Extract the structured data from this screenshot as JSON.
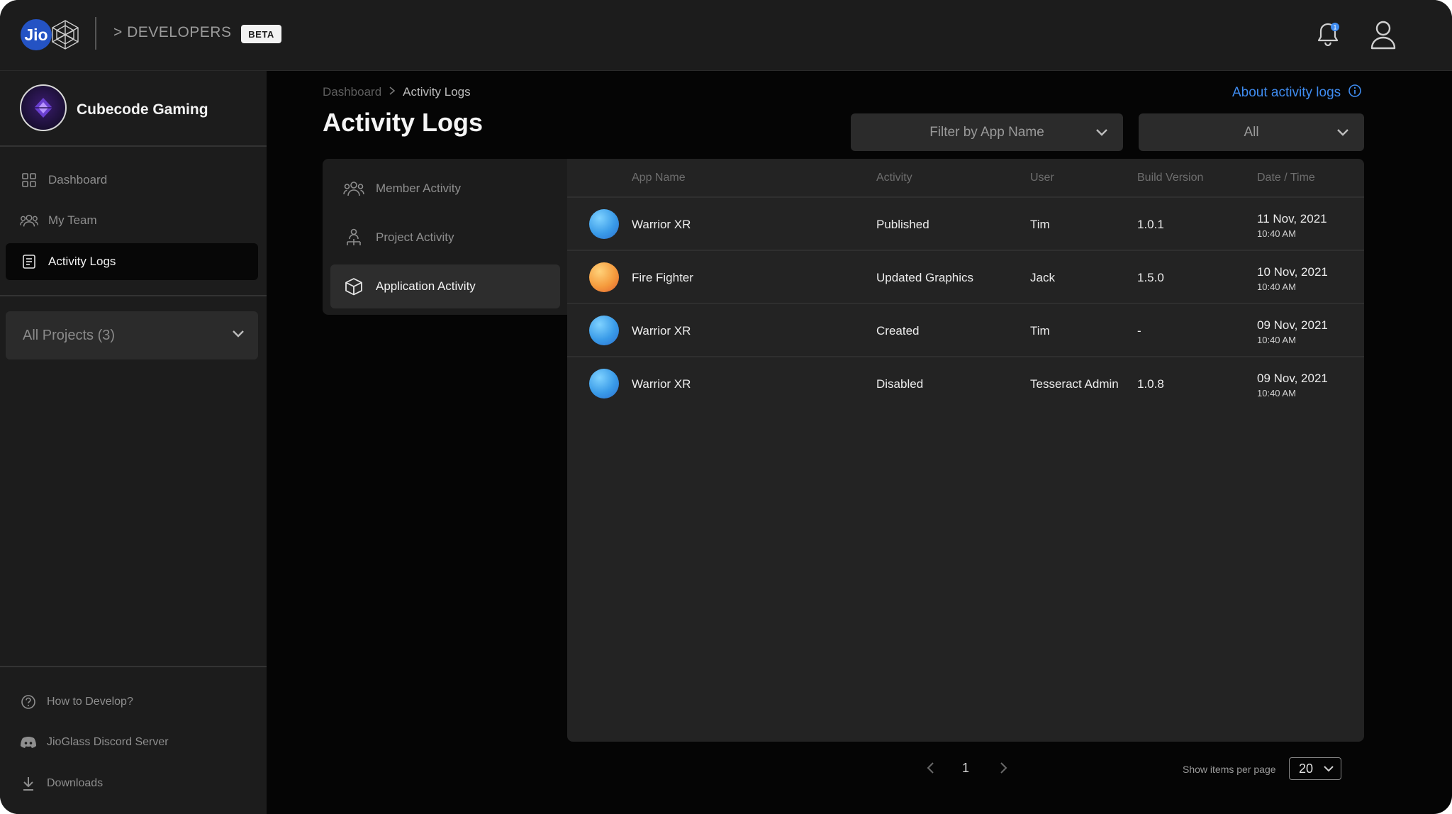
{
  "topbar": {
    "logo_text": "Jio",
    "section_label": "> DEVELOPERS",
    "badge": "BETA",
    "notification_count": "1"
  },
  "sidebar": {
    "org_name": "Cubecode Gaming",
    "nav": [
      {
        "label": "Dashboard",
        "icon": "dashboard-icon",
        "active": false
      },
      {
        "label": "My Team",
        "icon": "team-icon",
        "active": false
      },
      {
        "label": "Activity Logs",
        "icon": "logs-icon",
        "active": true
      }
    ],
    "projects_select": "All Projects (3)",
    "bottom": [
      {
        "label": "How to Develop?",
        "icon": "help-icon"
      },
      {
        "label": "JioGlass Discord Server",
        "icon": "discord-icon"
      },
      {
        "label": "Downloads",
        "icon": "download-icon"
      }
    ]
  },
  "main": {
    "breadcrumb": [
      "Dashboard",
      "Activity Logs"
    ],
    "about_link": "About activity logs",
    "title": "Activity Logs",
    "filter_app_placeholder": "Filter by App Name",
    "filter_status": "All",
    "tabs": [
      {
        "label": "Member Activity",
        "icon": "members-icon",
        "active": false
      },
      {
        "label": "Project Activity",
        "icon": "project-icon",
        "active": false
      },
      {
        "label": "Application Activity",
        "icon": "cube-icon",
        "active": true
      }
    ],
    "table": {
      "headers": [
        "App Name",
        "Activity",
        "User",
        "Build Version",
        "Date / Time"
      ],
      "rows": [
        {
          "app": "Warrior XR",
          "color": "blue",
          "activity": "Published",
          "user": "Tim",
          "build": "1.0.1",
          "date": "11 Nov, 2021",
          "time": "10:40 AM"
        },
        {
          "app": "Fire Fighter",
          "color": "orange",
          "activity": "Updated Graphics",
          "user": "Jack",
          "build": "1.5.0",
          "date": "10 Nov, 2021",
          "time": "10:40 AM"
        },
        {
          "app": "Warrior XR",
          "color": "blue",
          "activity": "Created",
          "user": "Tim",
          "build": "-",
          "date": "09 Nov, 2021",
          "time": "10:40 AM"
        },
        {
          "app": "Warrior XR",
          "color": "blue",
          "activity": "Disabled",
          "user": "Tesseract Admin",
          "build": "1.0.8",
          "date": "09 Nov, 2021",
          "time": "10:40 AM"
        }
      ]
    },
    "pagination": {
      "page": "1",
      "per_page_label": "Show items per page",
      "per_page": "20"
    }
  },
  "colors": {
    "accent_link": "#3f8cf0",
    "jio_blue": "#2453c4",
    "panel": "#232323",
    "sidebar": "#1c1c1c"
  }
}
